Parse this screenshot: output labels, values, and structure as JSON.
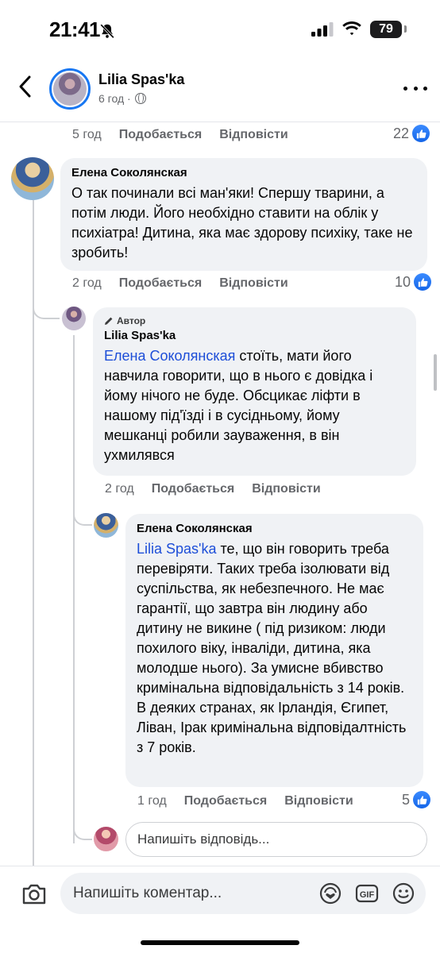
{
  "status_bar": {
    "time": "21:41",
    "battery": "79"
  },
  "header": {
    "name": "Lilia Spas'ka",
    "time": "6 год ·"
  },
  "top_actions": {
    "time": "5 год",
    "like": "Подобається",
    "reply": "Відповісти",
    "count": "22"
  },
  "comments": [
    {
      "author": "Елена Соколянская",
      "text": "О так починали всі ман'яки! Спершу тварини, а потім люди. Його необхідно ставити на облік у психіатра!  Дитина, яка має здорову психіку, таке не зробить!",
      "time": "2 год",
      "like": "Подобається",
      "reply": "Відповісти",
      "count": "10"
    },
    {
      "badge": "Автор",
      "author": "Lilia Spas'ka",
      "mention": "Елена Соколянская",
      "text": " стоїть, мати його навчила говорити, що в нього є довідка і йому нічого не буде. Обсцикає ліфти в нашому під'їзді і в сусідньому, йому мешканці робили зауваження, в він ухмилявся",
      "time": "2 год",
      "like": "Подобається",
      "reply": "Відповісти"
    },
    {
      "author": "Елена Соколянская",
      "mention": "Lilia Spas'ka",
      "text": " те, що він говорить треба перевіряти. Таких треба ізолювати від суспільства, як небезпечного. Не має гарантії, що завтра він людину або дитину не викине ( під ризиком: люди похилого віку,  інваліди, дитина, яка молодше нього). За умисне вбивство кримінальна відповідальність з 14 років. В деяких  странах, як Ірландія, Єгипет, Ліван, Ірак кримінальна відповідалтність з 7 років.",
      "time": "1 год",
      "like": "Подобається",
      "reply": "Відповісти",
      "count": "5"
    }
  ],
  "reply_input": {
    "placeholder": "Напишіть відповідь..."
  },
  "composer": {
    "placeholder": "Напишіть коментар...",
    "gif": "GIF"
  },
  "colors": {
    "accent": "#1877f2",
    "bubble": "#f0f2f5",
    "mention": "#1d4ed8",
    "muted": "#65676b"
  }
}
